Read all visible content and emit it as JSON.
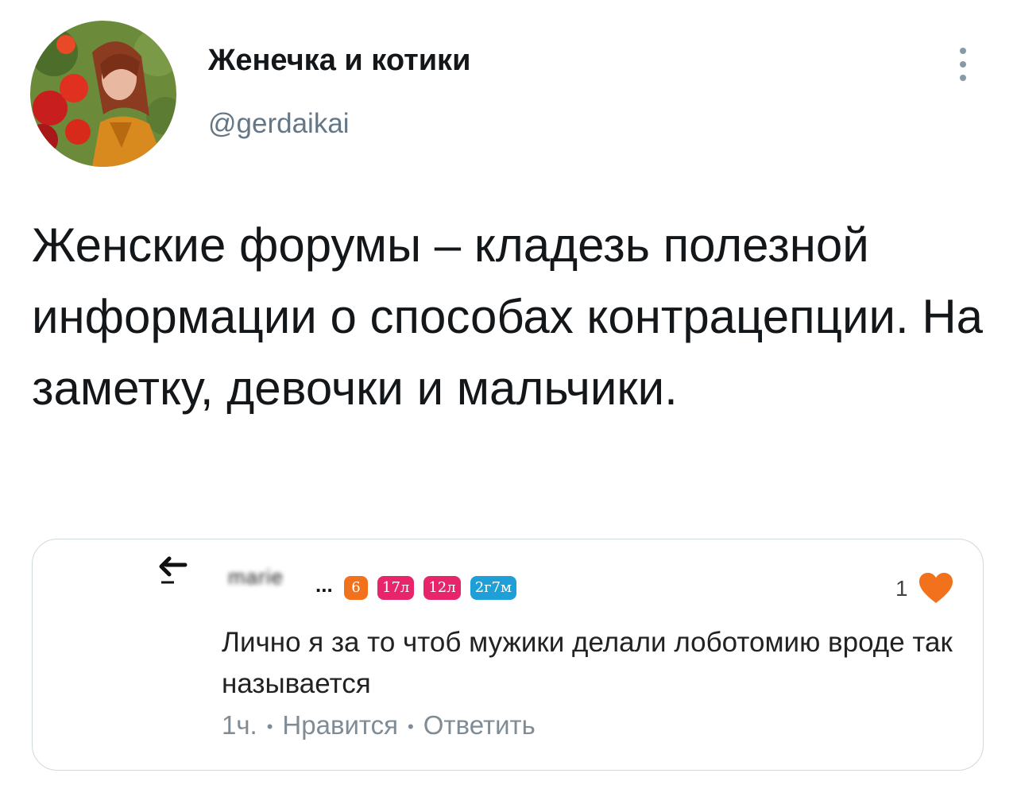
{
  "tweet": {
    "display_name": "Женечка и котики",
    "username": "@gerdaikai",
    "text": "Женские форумы – кладезь полезной информации о способах контрацепции. На заметку, девочки и мальчики.",
    "more_icon": "vertical-dots-icon",
    "avatar_icon": "profile-photo"
  },
  "embedded_comment": {
    "back_icon": "back-arrow-icon",
    "author_name": "marie",
    "author_ellipsis": "...",
    "badges": [
      {
        "label": "6",
        "color": "#f2711c"
      },
      {
        "label": "17л",
        "color": "#e8246a"
      },
      {
        "label": "12л",
        "color": "#e8246a"
      },
      {
        "label": "2г7м",
        "color": "#1e9fd8"
      }
    ],
    "like_count": "1",
    "like_icon": "heart-icon",
    "like_color": "#f2711c",
    "text": "Лично я за то чтоб мужики делали лоботомию вроде так называется",
    "time": "1ч.",
    "separator": "•",
    "like_action": "Нравится",
    "reply_action": "Ответить"
  }
}
